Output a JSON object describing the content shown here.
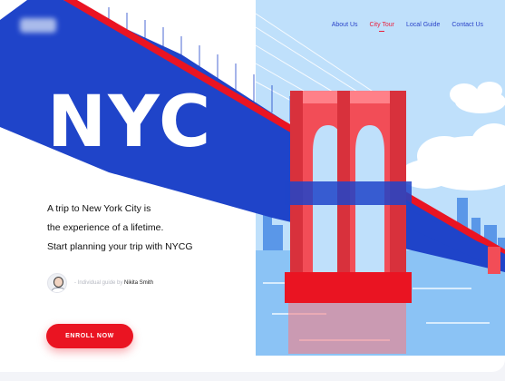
{
  "brand": {
    "logo_alt": "blurred-logo"
  },
  "nav": {
    "items": [
      {
        "label": "About Us",
        "active": false
      },
      {
        "label": "City Tour",
        "active": true
      },
      {
        "label": "Local Guide",
        "active": false
      },
      {
        "label": "Contact Us",
        "active": false
      }
    ]
  },
  "hero": {
    "title": "NYC",
    "tagline": [
      "A trip to New York City is",
      "the experience of a lifetime.",
      "Start planning your trip with NYCG"
    ]
  },
  "guide": {
    "prefix": "- Individual guide by",
    "name": "Nikita Smith",
    "avatar_icon": "person-avatar"
  },
  "cta": {
    "label": "ENROLL NOW"
  },
  "colors": {
    "blue": "#1f44c9",
    "red": "#ea1422",
    "nav_active": "#ea1f3d",
    "sky": "#bfe0fb"
  }
}
